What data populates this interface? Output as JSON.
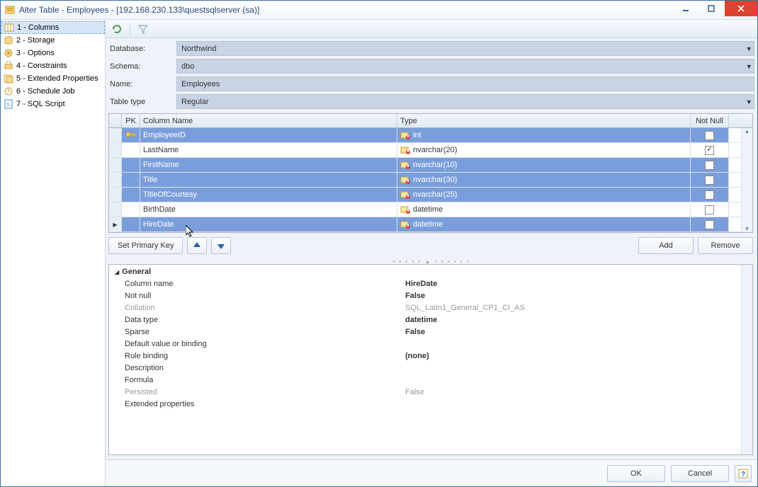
{
  "title": "Alter Table - Employees - [192.168.230.133\\questsqlserver (sa)]",
  "sidebar": {
    "items": [
      {
        "label": "1 - Columns"
      },
      {
        "label": "2 - Storage"
      },
      {
        "label": "3 - Options"
      },
      {
        "label": "4 - Constraints"
      },
      {
        "label": "5 - Extended Properties"
      },
      {
        "label": "6 - Schedule Job"
      },
      {
        "label": "7 - SQL Script"
      }
    ]
  },
  "form": {
    "database_label": "Database:",
    "database_value": "Northwind",
    "schema_label": "Schema:",
    "schema_value": "dbo",
    "name_label": "Name:",
    "name_value": "Employees",
    "tabletype_label": "Table type",
    "tabletype_value": "Regular"
  },
  "grid": {
    "headers": {
      "pk": "PK",
      "cname": "Column Name",
      "ctype": "Type",
      "nn": "Not Null"
    },
    "rows": [
      {
        "pk": true,
        "name": "EmployeeID",
        "type": "int",
        "notnull": true,
        "selected": true,
        "current": false
      },
      {
        "pk": false,
        "name": "LastName",
        "type": "nvarchar(20)",
        "notnull": true,
        "selected": false,
        "current": false
      },
      {
        "pk": false,
        "name": "FirstName",
        "type": "nvarchar(10)",
        "notnull": true,
        "selected": true,
        "current": false
      },
      {
        "pk": false,
        "name": "Title",
        "type": "nvarchar(30)",
        "notnull": false,
        "selected": true,
        "current": false
      },
      {
        "pk": false,
        "name": "TitleOfCourtesy",
        "type": "nvarchar(25)",
        "notnull": false,
        "selected": true,
        "current": false
      },
      {
        "pk": false,
        "name": "BirthDate",
        "type": "datetime",
        "notnull": false,
        "selected": false,
        "current": false
      },
      {
        "pk": false,
        "name": "HireDate",
        "type": "datetime",
        "notnull": false,
        "selected": true,
        "current": true
      }
    ]
  },
  "actions": {
    "set_pk": "Set Primary Key",
    "add": "Add",
    "remove": "Remove"
  },
  "props": {
    "group": "General",
    "rows": [
      {
        "key": "Column name",
        "val": "HireDate",
        "bold": true
      },
      {
        "key": "Not null",
        "val": "False",
        "bold": true
      },
      {
        "key": "Collation",
        "val": "SQL_Latin1_General_CP1_CI_AS",
        "dim": true
      },
      {
        "key": "Data type",
        "val": "datetime",
        "bold": true
      },
      {
        "key": "Sparse",
        "val": "False",
        "bold": true
      },
      {
        "key": "Default value or binding",
        "val": ""
      },
      {
        "key": "Rule binding",
        "val": "(none)",
        "bold": true
      },
      {
        "key": "Description",
        "val": ""
      },
      {
        "key": "Formula",
        "val": ""
      },
      {
        "key": "Persisted",
        "val": "False",
        "dim": true
      },
      {
        "key": "Extended properties",
        "val": ""
      }
    ]
  },
  "footer": {
    "ok": "OK",
    "cancel": "Cancel"
  }
}
